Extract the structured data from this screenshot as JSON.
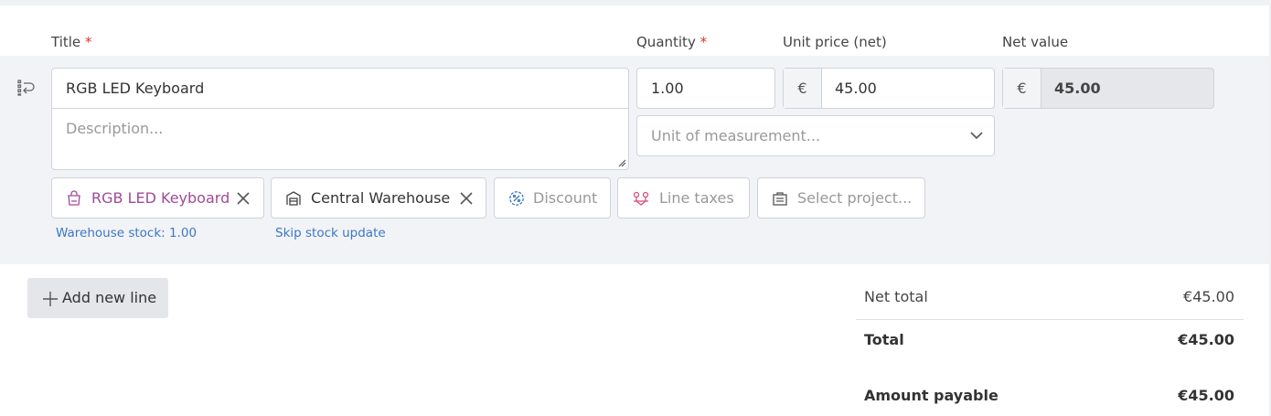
{
  "headers": {
    "title": "Title",
    "quantity": "Quantity",
    "unit_price": "Unit price (net)",
    "net_value": "Net value",
    "required_mark": "*"
  },
  "line": {
    "title_value": "RGB LED Keyboard",
    "description_placeholder": "Description...",
    "quantity_value": "1.00",
    "currency_symbol": "€",
    "unit_price_value": "45.00",
    "net_value": "45.00",
    "unit_placeholder": "Unit of measurement...",
    "chips": {
      "product": "RGB LED Keyboard",
      "warehouse": "Central Warehouse",
      "discount": "Discount",
      "line_taxes": "Line taxes",
      "project": "Select project..."
    },
    "warehouse_stock": "Warehouse stock: 1.00",
    "skip_stock": "Skip stock update"
  },
  "add_line_label": "Add new line",
  "summary": {
    "net_total_label": "Net total",
    "net_total_value": "€45.00",
    "total_label": "Total",
    "total_value": "€45.00",
    "payable_label": "Amount payable",
    "payable_value": "€45.00"
  },
  "colors": {
    "product_chip": "#a04a9a",
    "link": "#3a78c3",
    "required": "#dd3333",
    "taxes_icon": "#d9507a",
    "discount_icon": "#3a78c3"
  }
}
